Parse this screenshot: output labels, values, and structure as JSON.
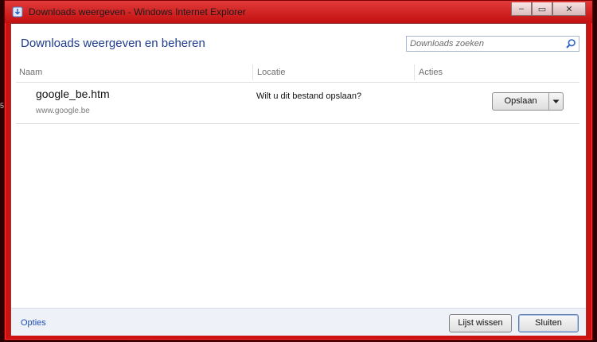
{
  "window": {
    "title": "Downloads weergeven - Windows Internet Explorer",
    "frame_color": "#cc1111"
  },
  "caption_buttons": {
    "minimize": "–",
    "restore": "▭",
    "close": "✕"
  },
  "header": {
    "title": "Downloads weergeven en beheren",
    "search_placeholder": "Downloads zoeken"
  },
  "columns": [
    "Naam",
    "Locatie",
    "Acties"
  ],
  "downloads": [
    {
      "name": "google_be.htm",
      "source": "www.google.be",
      "location_text": "Wilt u dit bestand opslaan?",
      "action_label": "Opslaan"
    }
  ],
  "footer": {
    "options_label": "Opties",
    "clear_label": "Lijst wissen",
    "close_label": "Sluiten"
  },
  "icons": {
    "app": "ie-downloads-icon",
    "search": "search-icon",
    "dropdown": "chevron-down-icon"
  }
}
